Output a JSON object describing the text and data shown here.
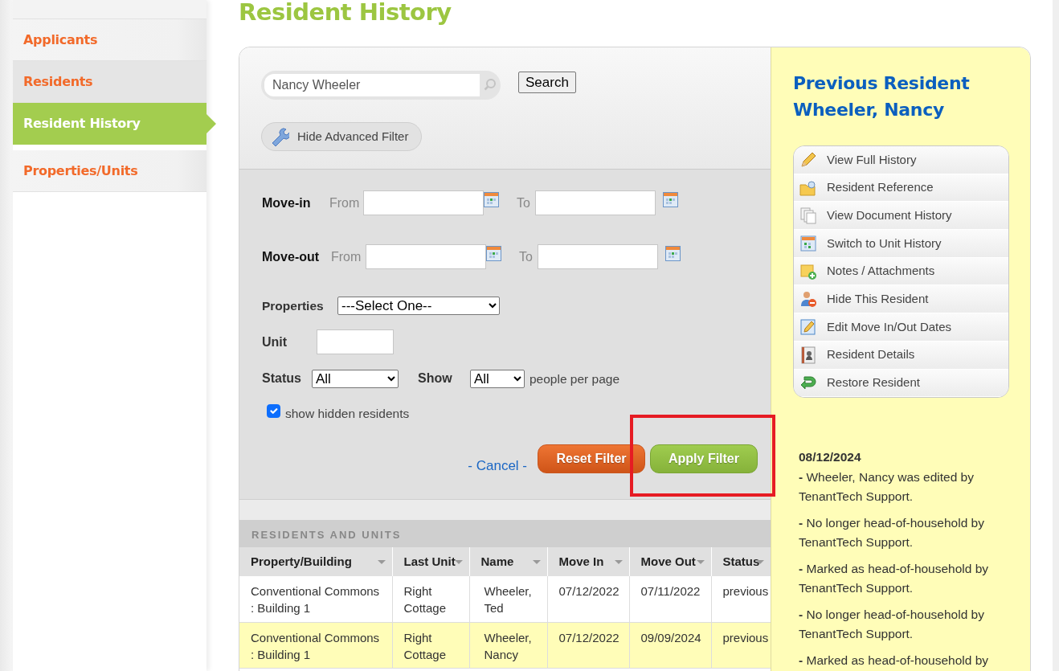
{
  "sidebar": {
    "items": [
      {
        "label": "Applicants",
        "selected": false,
        "hovered": false
      },
      {
        "label": "Residents",
        "selected": false,
        "hovered": true
      },
      {
        "label": "Resident History",
        "selected": true,
        "hovered": false
      },
      {
        "label": "Properties/Units",
        "selected": false,
        "hovered": false
      }
    ]
  },
  "page_title": "Resident History",
  "search": {
    "value": "Nancy Wheeler",
    "button": "Search",
    "toggle_button": "Hide Advanced Filter"
  },
  "filter": {
    "move_in": {
      "label": "Move-in",
      "from_label": "From",
      "to_label": "To"
    },
    "move_out": {
      "label": "Move-out",
      "from_label": "From",
      "to_label": "To"
    },
    "properties": {
      "label": "Properties",
      "value": "---Select One--"
    },
    "unit": {
      "label": "Unit"
    },
    "status": {
      "label": "Status",
      "value": "All"
    },
    "show": {
      "label": "Show",
      "value": "All",
      "suffix": "people per page"
    },
    "show_hidden": {
      "label": "show hidden residents",
      "checked": true
    },
    "cancel": "- Cancel -",
    "reset_button": "Reset Filter",
    "apply_button": {
      "label": "Apply Filter",
      "highlighted": true
    }
  },
  "table": {
    "title": "RESIDENTS AND UNITS",
    "columns": [
      "Property/Building",
      "Last Unit",
      "Name",
      "Move In",
      "Move Out",
      "Status"
    ],
    "rows": [
      {
        "cells": [
          "Conventional Commons : Building 1",
          "Right Cottage",
          "Wheeler, Ted",
          "07/12/2022",
          "07/11/2022",
          "previous"
        ],
        "selected": false
      },
      {
        "cells": [
          "Conventional Commons : Building 1",
          "Right Cottage",
          "Wheeler, Nancy",
          "07/12/2022",
          "09/09/2024",
          "previous"
        ],
        "selected": true
      }
    ]
  },
  "detail": {
    "title_lines": [
      "Previous Resident",
      "Wheeler, Nancy"
    ],
    "actions": [
      "View Full History",
      "Resident Reference",
      "View Document History",
      "Switch to Unit History",
      "Notes / Attachments",
      "Hide This Resident",
      "Edit Move In/Out Dates",
      "Resident Details",
      "Restore Resident"
    ],
    "log": {
      "date": "08/12/2024",
      "entries": [
        "**-** Wheeler, Nancy was edited by TenantTech Support.",
        "**-** No longer head-of-household by TenantTech Support.",
        "**-** Marked as head-of-household by TenantTech Support.",
        "**-** No longer head-of-household by TenantTech Support.",
        "**-** Marked as head-of-household by"
      ]
    }
  }
}
